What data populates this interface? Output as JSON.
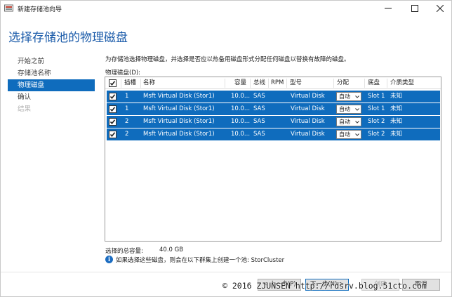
{
  "window": {
    "title": "新建存储池向导",
    "minimize": "—",
    "maximize": "☐",
    "close": "✕"
  },
  "page_title": "选择存储池的物理磁盘",
  "nav": [
    {
      "label": "开始之前",
      "state": "normal"
    },
    {
      "label": "存储池名称",
      "state": "normal"
    },
    {
      "label": "物理磁盘",
      "state": "active"
    },
    {
      "label": "确认",
      "state": "normal"
    },
    {
      "label": "结果",
      "state": "disabled"
    }
  ],
  "description": "为存储池选择物理磁盘，并选择是否应以热备用磁盘形式分配任何磁盘以替换有故障的磁盘。",
  "list_label": "物理磁盘(D):",
  "table": {
    "headers": {
      "slot": "插槽",
      "name": "名称",
      "capacity": "容量",
      "bus": "总线",
      "rpm": "RPM",
      "model": "型号",
      "allocation": "分配",
      "chassis": "底盘",
      "media": "介质类型"
    },
    "rows": [
      {
        "checked": true,
        "slot": "1",
        "name": "Msft Virtual Disk (Stor1)",
        "capacity": "10.0...",
        "bus": "SAS",
        "rpm": "",
        "model": "Virtual Disk",
        "allocation": "自动",
        "chassis": "Slot 1",
        "media": "未知"
      },
      {
        "checked": true,
        "slot": "1",
        "name": "Msft Virtual Disk (Stor1)",
        "capacity": "10.0...",
        "bus": "SAS",
        "rpm": "",
        "model": "Virtual Disk",
        "allocation": "自动",
        "chassis": "Slot 1",
        "media": "未知"
      },
      {
        "checked": true,
        "slot": "2",
        "name": "Msft Virtual Disk (Stor1)",
        "capacity": "10.0...",
        "bus": "SAS",
        "rpm": "",
        "model": "Virtual Disk",
        "allocation": "自动",
        "chassis": "Slot 2",
        "media": "未知"
      },
      {
        "checked": true,
        "slot": "2",
        "name": "Msft Virtual Disk (Stor1)",
        "capacity": "10.0...",
        "bus": "SAS",
        "rpm": "",
        "model": "Virtual Disk",
        "allocation": "自动",
        "chassis": "Slot 2",
        "media": "未知"
      }
    ]
  },
  "summary": {
    "label": "选择的总容量:",
    "value": "40.0 GB"
  },
  "info_text": "如果选择这些磁盘，则会在以下群集上创建一个池: StorCluster",
  "buttons": {
    "previous": "< 上一步(P)",
    "next": "下一步(N) >",
    "create": "创建",
    "cancel": "取消"
  },
  "watermark": "© 2016 ZJUNSEN http://rdsrv.blog.51cto.com",
  "colors": {
    "accent": "#0f6cbd",
    "title": "#1c5caa"
  }
}
